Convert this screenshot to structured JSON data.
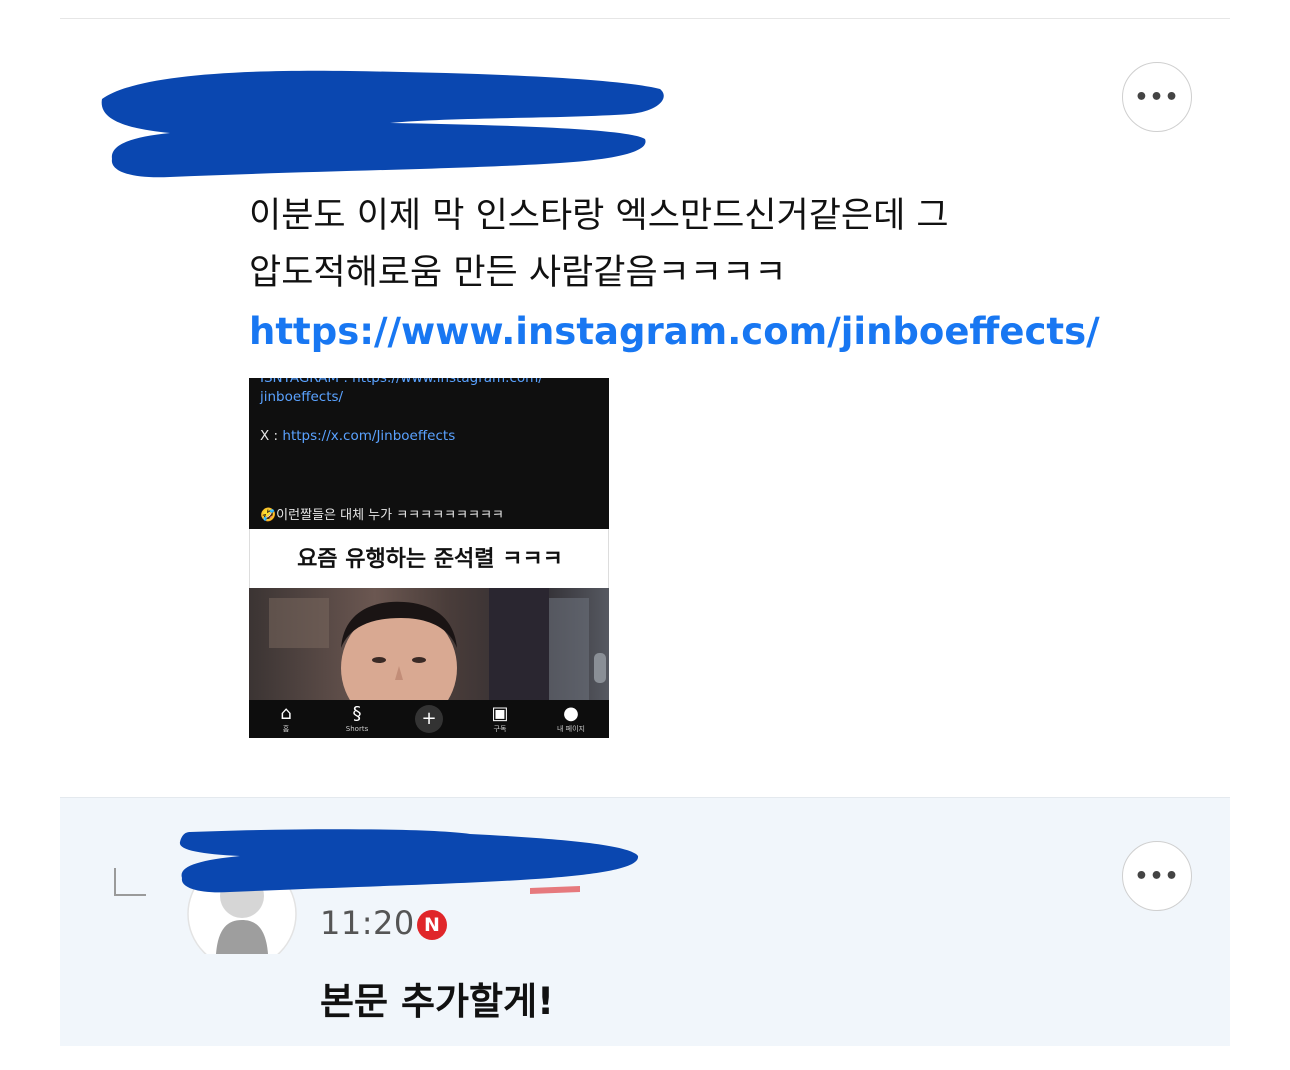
{
  "comments": [
    {
      "text_line1": "이분도 이제 막 인스타랑 엑스만드신거같은데 그",
      "text_line2": "압도적해로움 만든 사람같음ㅋㅋㅋㅋ",
      "link": "https://www.instagram.com/jinboeffects/",
      "more_label": "•••",
      "attachment": {
        "line_top": "ISNTAGRAM : https://www.instagram.com/",
        "line_link_cont": "jinboeffects/",
        "x_label": "X : ",
        "x_link": "https://x.com/Jinboeffects",
        "caption": "🤣이런짤들은 대체 누가 ㅋㅋㅋㅋㅋㅋㅋㅋㅋ",
        "title": "요즘 유행하는 준석렬 ㅋㅋㅋ",
        "nav": [
          {
            "icon": "home-icon",
            "label": "홈"
          },
          {
            "icon": "shorts-icon",
            "label": "Shorts"
          },
          {
            "icon": "plus-icon",
            "label": ""
          },
          {
            "icon": "subscriptions-icon",
            "label": "구독"
          },
          {
            "icon": "avatar-icon",
            "label": "내 페이지"
          }
        ]
      }
    },
    {
      "time": "11:20",
      "badge": "N",
      "text": "본문 추가할게!",
      "more_label": "•••"
    }
  ],
  "colors": {
    "link": "#1877f2",
    "redaction": "#0a47b0",
    "reply_bg": "#f1f6fb",
    "new_badge": "#e0262a"
  }
}
